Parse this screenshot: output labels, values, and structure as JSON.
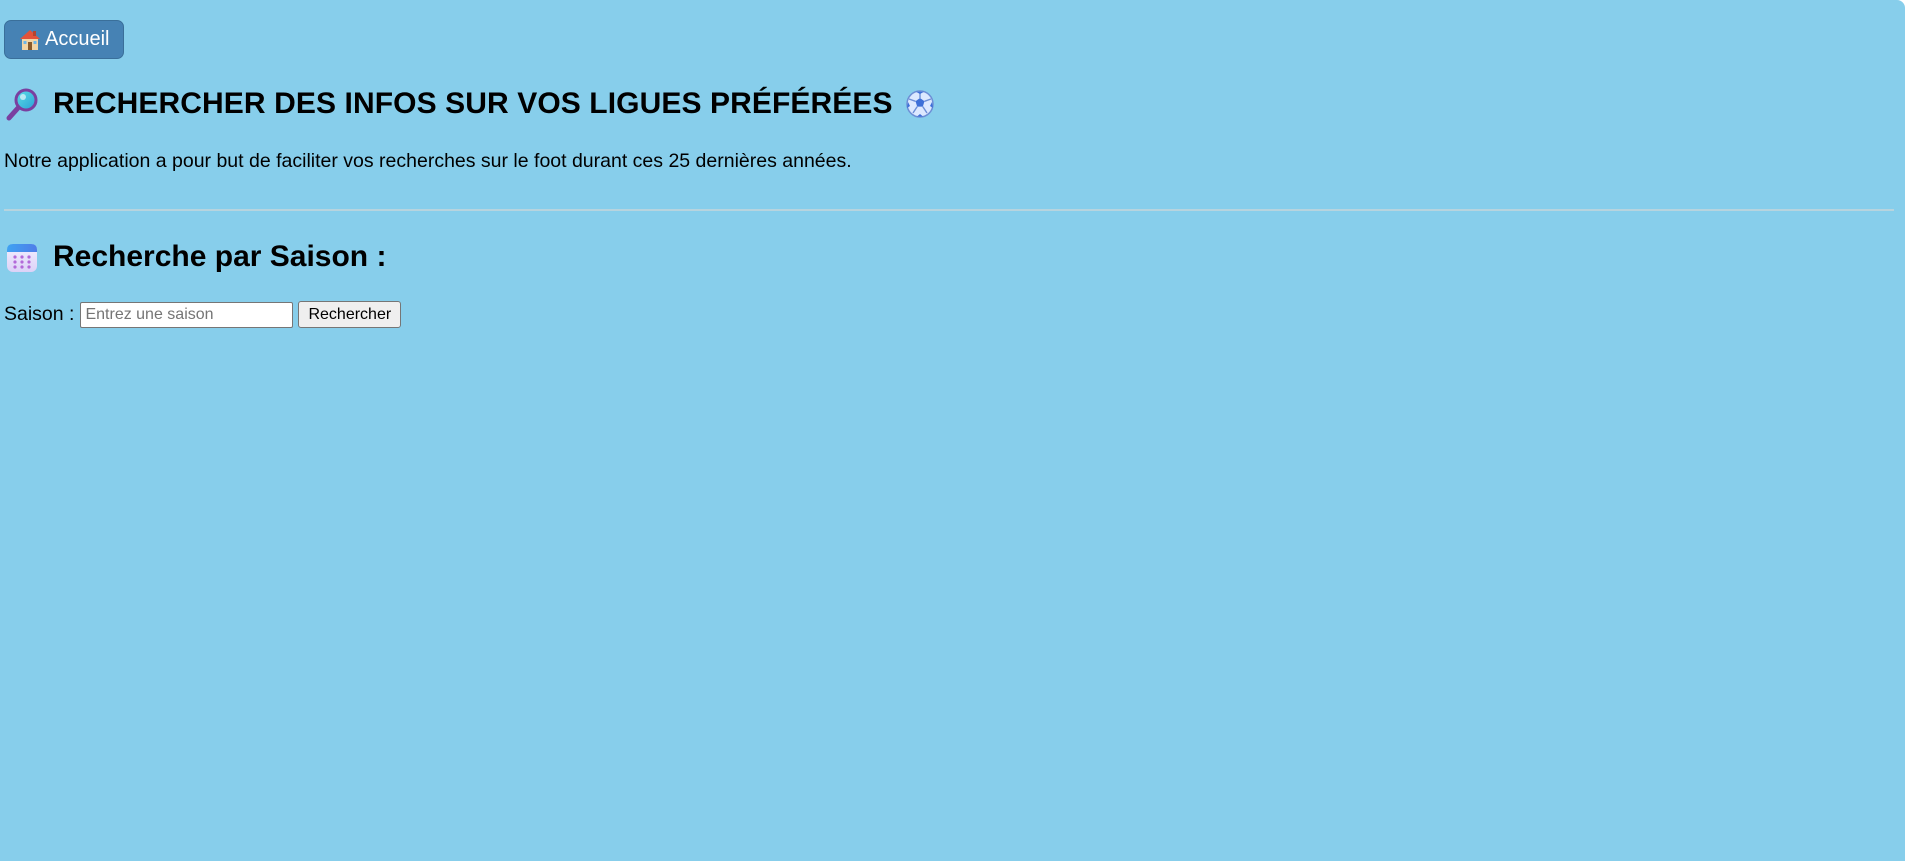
{
  "nav": {
    "home_label": "Accueil",
    "home_icon": "house-icon"
  },
  "header": {
    "title": "RECHERCHER DES INFOS SUR VOS LIGUES PRÉFÉRÉES",
    "leading_icon": "magnifying-glass-icon",
    "trailing_icon": "soccer-ball-icon",
    "intro": "Notre application a pour but de faciliter vos recherches sur le foot durant ces 25 dernières années."
  },
  "season_search": {
    "heading": "Recherche par Saison :",
    "heading_icon": "calendar-icon",
    "label": "Saison :",
    "input_placeholder": "Entrez une saison",
    "input_value": "",
    "button_label": "Rechercher"
  },
  "colors": {
    "background": "#87ceeb",
    "home_button": "#4682b4"
  }
}
